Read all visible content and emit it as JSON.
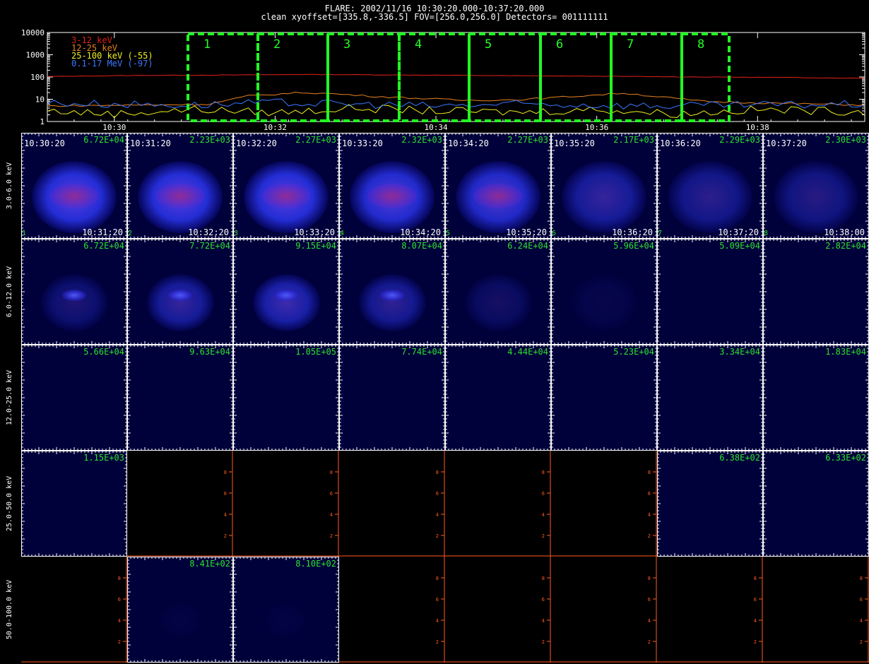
{
  "header": {
    "line1": "FLARE: 2002/11/16 10:30:20.000-10:37:20.000",
    "line2": "clean   xyoffset=[335.8,-336.5]   FOV=[256.0,256.0]   Detectors= 001111111"
  },
  "chart_data": [
    {
      "type": "line",
      "yscale": "log",
      "ylim": [
        1,
        10000
      ],
      "ytick_labels": [
        "1",
        "10",
        "100",
        "1000",
        "10000"
      ],
      "xlim": [
        "10:29:10",
        "10:39:20"
      ],
      "xtick_labels": [
        "10:30",
        "10:32",
        "10:34",
        "10:36",
        "10:38"
      ],
      "legend": [
        {
          "label": "3-12 keV",
          "color": "#e0201a"
        },
        {
          "label": "12-25 keV",
          "color": "#e88020"
        },
        {
          "label": "25-100 keV (-55)",
          "color": "#f0f020"
        },
        {
          "label": "0.1-17 MeV (-97)",
          "color": "#3a78ff"
        }
      ],
      "series": [
        {
          "name": "3-12 keV",
          "color": "#e0201a",
          "x": [
            "10:29:10",
            "10:30:20",
            "10:31:20",
            "10:32:20",
            "10:33:20",
            "10:34:20",
            "10:35:20",
            "10:36:20",
            "10:37:20",
            "10:38:20",
            "10:39:20"
          ],
          "y": [
            105,
            118,
            122,
            130,
            125,
            118,
            112,
            106,
            100,
            95,
            88
          ]
        },
        {
          "name": "12-25 keV",
          "color": "#e88020",
          "x": [
            "10:29:10",
            "10:30:20",
            "10:31:10",
            "10:31:40",
            "10:32:20",
            "10:32:40",
            "10:33:20",
            "10:34:20",
            "10:35:00",
            "10:35:30",
            "10:36:20",
            "10:37:20",
            "10:38:20",
            "10:39:20"
          ],
          "y": [
            5,
            5.5,
            6,
            14,
            20,
            18,
            13,
            9,
            9.5,
            12,
            19,
            8,
            6.5,
            5.5
          ]
        },
        {
          "name": "25-100 keV (-55)",
          "color": "#f0f020",
          "x": [
            "10:29:10",
            "10:30:00",
            "10:31:00",
            "10:32:00",
            "10:33:00",
            "10:34:00",
            "10:35:00",
            "10:36:00",
            "10:37:00",
            "10:38:00",
            "10:39:20"
          ],
          "y": [
            3,
            2.2,
            3.5,
            2.5,
            4,
            3,
            2.6,
            3.5,
            2.2,
            3.4,
            2.8
          ]
        },
        {
          "name": "0.1-17 MeV (-97)",
          "color": "#3a78ff",
          "x": [
            "10:29:10",
            "10:30:00",
            "10:31:00",
            "10:32:00",
            "10:33:00",
            "10:34:00",
            "10:35:00",
            "10:36:00",
            "10:37:00",
            "10:38:00",
            "10:39:20"
          ],
          "y": [
            7,
            6,
            5.5,
            7,
            6,
            5,
            6,
            5.5,
            5,
            5.5,
            6
          ]
        }
      ],
      "intervals": [
        "1",
        "2",
        "3",
        "4",
        "5",
        "6",
        "7",
        "8"
      ],
      "interval_color": "#22ff22"
    },
    {
      "type": "heatmap",
      "description_rows": [
        "3.0-6.0 keV",
        "6.0-12.0 keV",
        "12.0-25.0 keV",
        "25.0-50.0 keV",
        "50.0-100.0 keV"
      ],
      "columns": [
        {
          "index": "1",
          "start": "10:30:20",
          "end": "10:31:20"
        },
        {
          "index": "2",
          "start": "10:31:20",
          "end": "10:32:20"
        },
        {
          "index": "3",
          "start": "10:32:20",
          "end": "10:33:20"
        },
        {
          "index": "4",
          "start": "10:33:20",
          "end": "10:34:20"
        },
        {
          "index": "5",
          "start": "10:34:20",
          "end": "10:35:20"
        },
        {
          "index": "6",
          "start": "10:35:20",
          "end": "10:36:20"
        },
        {
          "index": "7",
          "start": "10:36:20",
          "end": "10:37:20"
        },
        {
          "index": "8",
          "start": "10:37:20",
          "end": "10:38:00"
        }
      ],
      "peak_values": [
        [
          "6.72E+04",
          "2.23E+03",
          "2.27E+03",
          "2.32E+03",
          "2.27E+03",
          "2.17E+03",
          "2.29E+03",
          "2.30E+03"
        ],
        [
          "6.72E+04",
          "7.72E+04",
          "9.15E+04",
          "8.07E+04",
          "6.24E+04",
          "5.96E+04",
          "5.09E+04",
          "2.82E+04"
        ],
        [
          "5.66E+04",
          "9.63E+04",
          "1.05E+05",
          "7.74E+04",
          "4.44E+04",
          "5.23E+04",
          "3.34E+04",
          "1.83E+04"
        ],
        [
          "1.15E+03",
          "",
          "",
          "",
          "",
          "",
          "6.38E+02",
          "6.33E+02"
        ],
        [
          "",
          "8.41E+02",
          "8.10E+02",
          "",
          "",
          "",
          "",
          ""
        ]
      ],
      "tile_state": [
        [
          "image",
          "image",
          "image",
          "image",
          "image",
          "image",
          "image",
          "image"
        ],
        [
          "image",
          "image",
          "image",
          "image",
          "image",
          "image",
          "image",
          "image"
        ],
        [
          "image",
          "image",
          "image",
          "image",
          "image",
          "image",
          "image",
          "image"
        ],
        [
          "image",
          "empty",
          "empty",
          "empty",
          "empty",
          "empty",
          "image",
          "image"
        ],
        [
          "empty",
          "image",
          "image",
          "empty",
          "empty",
          "empty",
          "empty",
          "empty"
        ]
      ],
      "empty_axis_ticks": [
        "2",
        "4",
        "6",
        "8"
      ],
      "empty_axis_color": "#ff5a1f",
      "label_color": "#2fe02f"
    }
  ]
}
